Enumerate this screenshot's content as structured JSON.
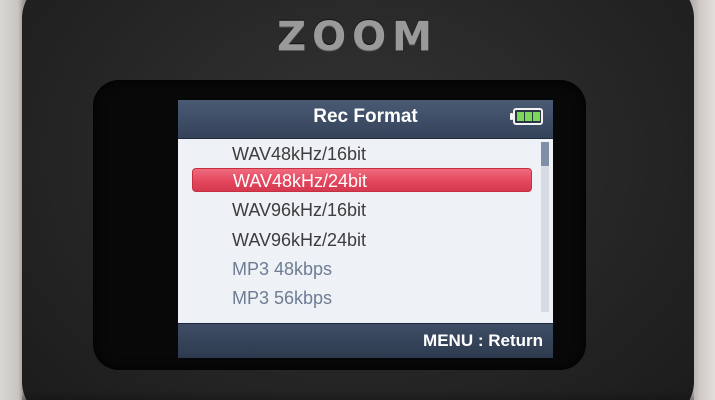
{
  "device": {
    "brand": "ZOOM"
  },
  "screen": {
    "title": "Rec Format",
    "battery_icon": "battery-full-icon",
    "footer_hint": "MENU : Return",
    "items": [
      {
        "label": "WAV48kHz/16bit",
        "state": "normal"
      },
      {
        "label": "WAV48kHz/24bit",
        "state": "selected"
      },
      {
        "label": "WAV96kHz/16bit",
        "state": "normal"
      },
      {
        "label": "WAV96kHz/24bit",
        "state": "normal"
      },
      {
        "label": "MP3 48kbps",
        "state": "dim"
      },
      {
        "label": "MP3 56kbps",
        "state": "dim"
      }
    ]
  },
  "colors": {
    "selection": "#e4475e",
    "title_bar": "#3d4c64",
    "battery_fill": "#7dd85a"
  }
}
